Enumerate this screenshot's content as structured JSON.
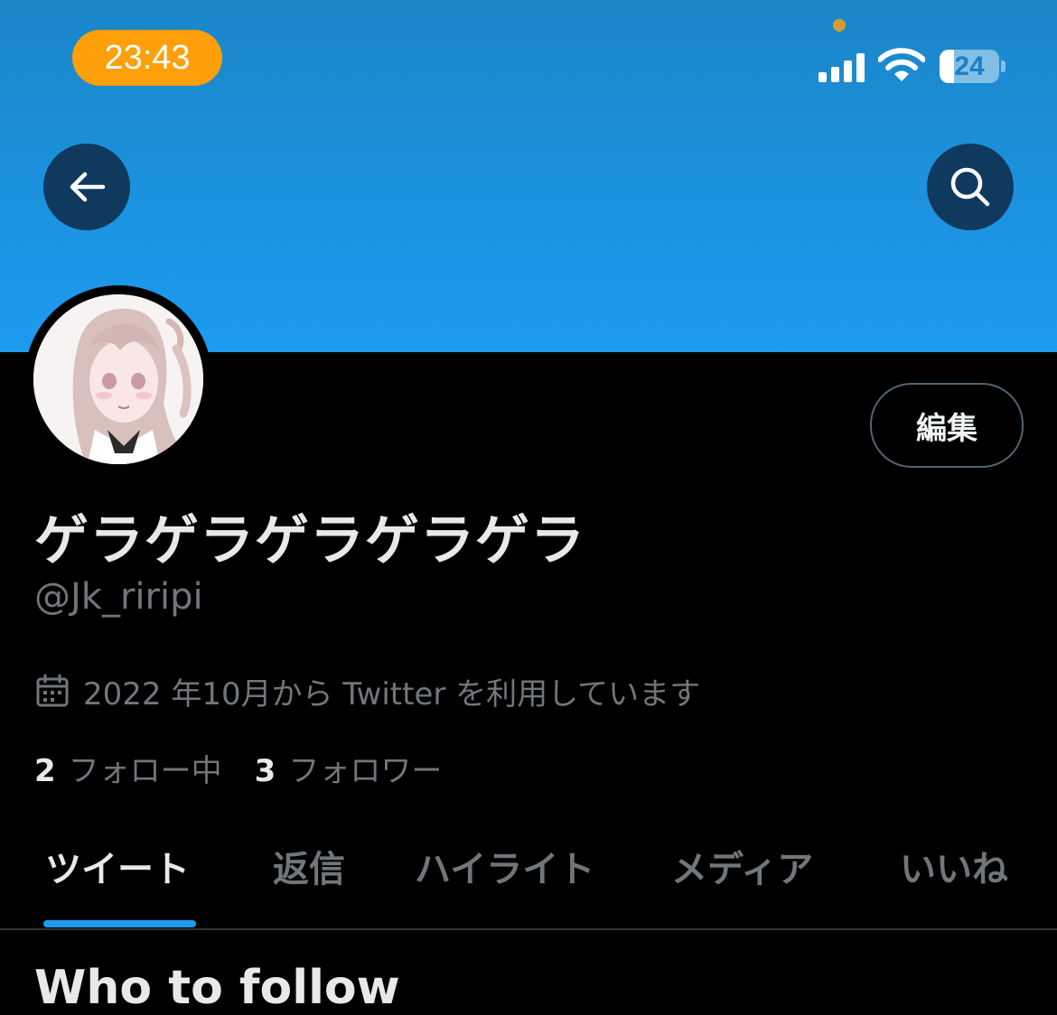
{
  "status_bar": {
    "time": "23:43",
    "battery_level": "24",
    "colors": {
      "time_pill": "#ff9f0a"
    }
  },
  "header": {
    "back_icon": "arrow-left-icon",
    "search_icon": "search-icon",
    "banner_color": "#1d9bf0"
  },
  "profile": {
    "avatar_icon": "avatar-illustration",
    "edit_label": "編集",
    "display_name": "ゲラゲラゲラゲラゲラ",
    "handle": "@Jk_riripi",
    "joined_icon": "calendar-icon",
    "joined": "2022 年10月から Twitter を利用しています",
    "following_count": "2",
    "following_label": "フォロー中",
    "followers_count": "3",
    "followers_label": "フォロワー"
  },
  "tabs": [
    {
      "label": "ツイート",
      "active": true
    },
    {
      "label": "返信",
      "active": false
    },
    {
      "label": "ハイライト",
      "active": false
    },
    {
      "label": "メディア",
      "active": false
    },
    {
      "label": "いいね",
      "active": false
    }
  ],
  "colors": {
    "accent": "#1d9bf0",
    "secondary_text": "#71767b"
  },
  "sections": {
    "who_to_follow": "Who to follow"
  }
}
